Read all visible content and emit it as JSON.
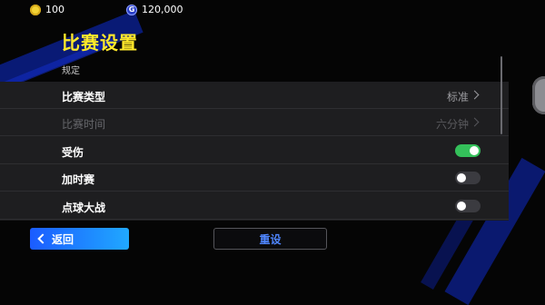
{
  "topbar": {
    "coins": {
      "value": "100",
      "icon": "coin-icon"
    },
    "gems": {
      "value": "120,000",
      "icon": "gem-icon",
      "glyph": "G"
    }
  },
  "page": {
    "title": "比赛设置",
    "section": "规定"
  },
  "settings": [
    {
      "label": "比赛类型",
      "type": "select",
      "value": "标准",
      "enabled": true
    },
    {
      "label": "比赛时间",
      "type": "select",
      "value": "六分钟",
      "enabled": false
    },
    {
      "label": "受伤",
      "type": "toggle",
      "on": true,
      "enabled": true
    },
    {
      "label": "加时赛",
      "type": "toggle",
      "on": false,
      "enabled": true
    },
    {
      "label": "点球大战",
      "type": "toggle",
      "on": false,
      "enabled": true
    }
  ],
  "footer": {
    "back_label": "返回",
    "reset_label": "重设"
  },
  "colors": {
    "title": "#ffe92a",
    "toggle_on": "#34c05a",
    "accent": "#1b5cff"
  }
}
